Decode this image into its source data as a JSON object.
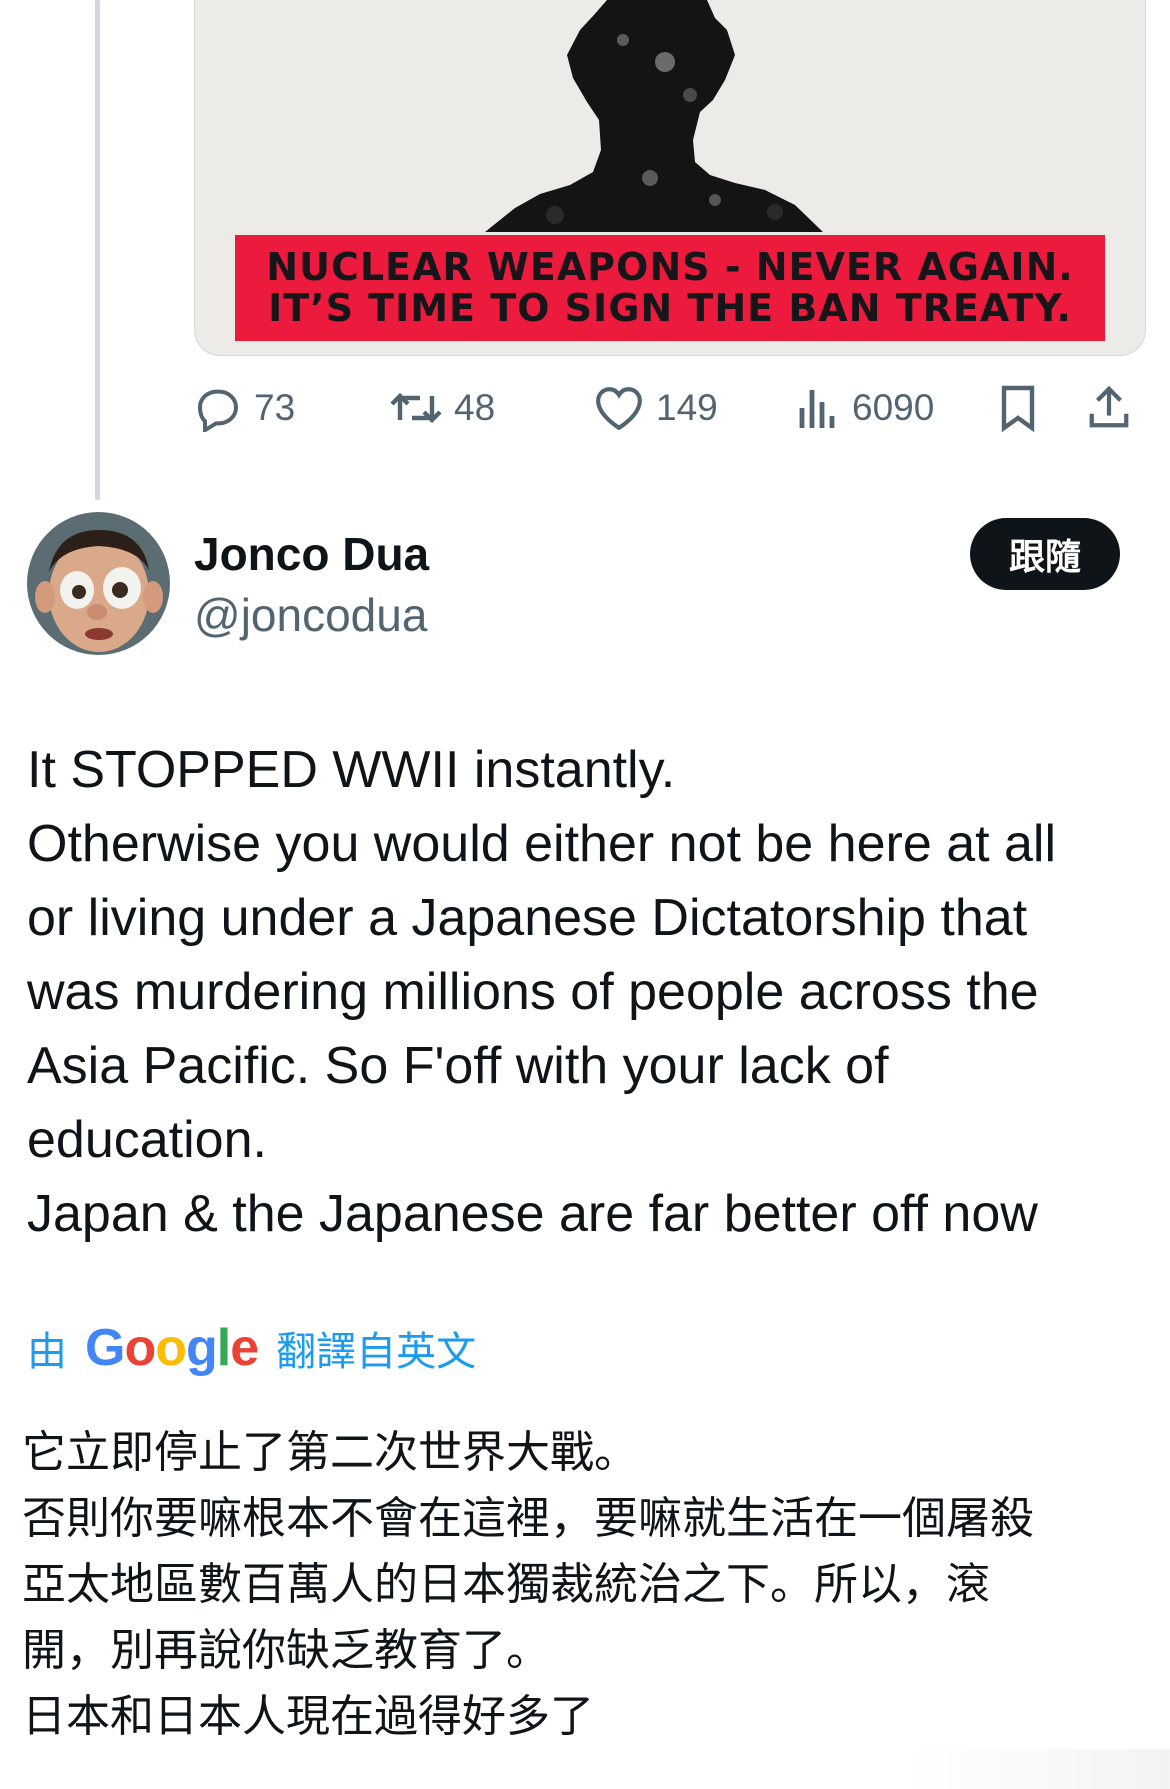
{
  "media": {
    "banner_line1": "NUCLEAR WEAPONS - NEVER AGAIN.",
    "banner_line2": "IT’S TIME TO SIGN THE BAN TREATY.",
    "banner_color": "#ec1a3d"
  },
  "actions": {
    "reply": {
      "icon": "reply-icon",
      "count": "73"
    },
    "retweet": {
      "icon": "retweet-icon",
      "count": "48"
    },
    "like": {
      "icon": "heart-icon",
      "count": "149"
    },
    "views": {
      "icon": "views-icon",
      "count": "6090"
    },
    "bookmark": {
      "icon": "bookmark-icon"
    },
    "share": {
      "icon": "share-icon"
    }
  },
  "reply_tweet": {
    "display_name": "Jonco Dua",
    "handle": "@joncodua",
    "follow_label": "跟隨",
    "text_lines": [
      "It STOPPED WWII instantly.",
      "Otherwise you would either not be here at all",
      "or living under a Japanese Dictatorship that",
      "was murdering millions of people across the",
      "Asia Pacific. So F'off with your lack of",
      "education.",
      "Japan & the Japanese are far better off now"
    ],
    "translation": {
      "prefix": "由",
      "provider": "Google",
      "suffix": "翻譯自英文",
      "lines": [
        "它立即停止了第二次世界大戰。",
        "否則你要嘛根本不會在這裡，要嘛就生活在一個屠殺",
        "亞太地區數百萬人的日本獨裁統治之下。所以，滾",
        "開，別再說你缺乏教育了。",
        "日本和日本人現在過得好多了"
      ]
    }
  },
  "colors": {
    "link_blue": "#1d9bf0",
    "secondary_text": "#536471",
    "follow_button_bg": "#0f1419"
  }
}
